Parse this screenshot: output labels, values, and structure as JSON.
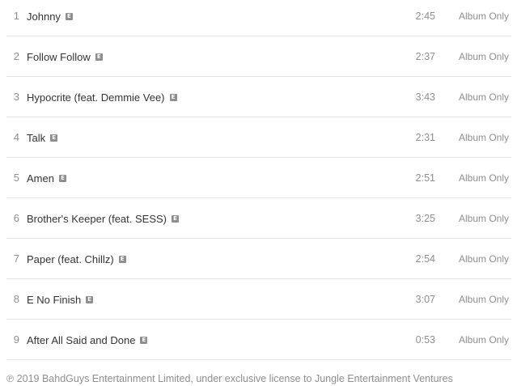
{
  "tracks": [
    {
      "number": "1",
      "title": "Johnny",
      "explicit": "E",
      "duration": "2:45",
      "price": "Album Only"
    },
    {
      "number": "2",
      "title": "Follow Follow",
      "explicit": "E",
      "duration": "2:37",
      "price": "Album Only"
    },
    {
      "number": "3",
      "title": "Hypocrite (feat. Demmie Vee)",
      "explicit": "E",
      "duration": "3:43",
      "price": "Album Only"
    },
    {
      "number": "4",
      "title": "Talk",
      "explicit": "E",
      "duration": "2:31",
      "price": "Album Only"
    },
    {
      "number": "5",
      "title": "Amen",
      "explicit": "E",
      "duration": "2:51",
      "price": "Album Only"
    },
    {
      "number": "6",
      "title": "Brother's Keeper (feat. SESS)",
      "explicit": "E",
      "duration": "3:25",
      "price": "Album Only"
    },
    {
      "number": "7",
      "title": "Paper (feat. Chillz)",
      "explicit": "E",
      "duration": "2:54",
      "price": "Album Only"
    },
    {
      "number": "8",
      "title": "E No Finish",
      "explicit": "E",
      "duration": "3:07",
      "price": "Album Only"
    },
    {
      "number": "9",
      "title": "After All Said and Done",
      "explicit": "E",
      "duration": "0:53",
      "price": "Album Only"
    }
  ],
  "copyright": "℗ 2019 BahdGuys Entertainment Limited, under exclusive license to Jungle Entertainment Ventures",
  "colors": {
    "text_primary": "#333333",
    "text_secondary": "#8e8e8e",
    "divider": "#e3e3e3",
    "explicit_badge": "#8e8e8e"
  }
}
